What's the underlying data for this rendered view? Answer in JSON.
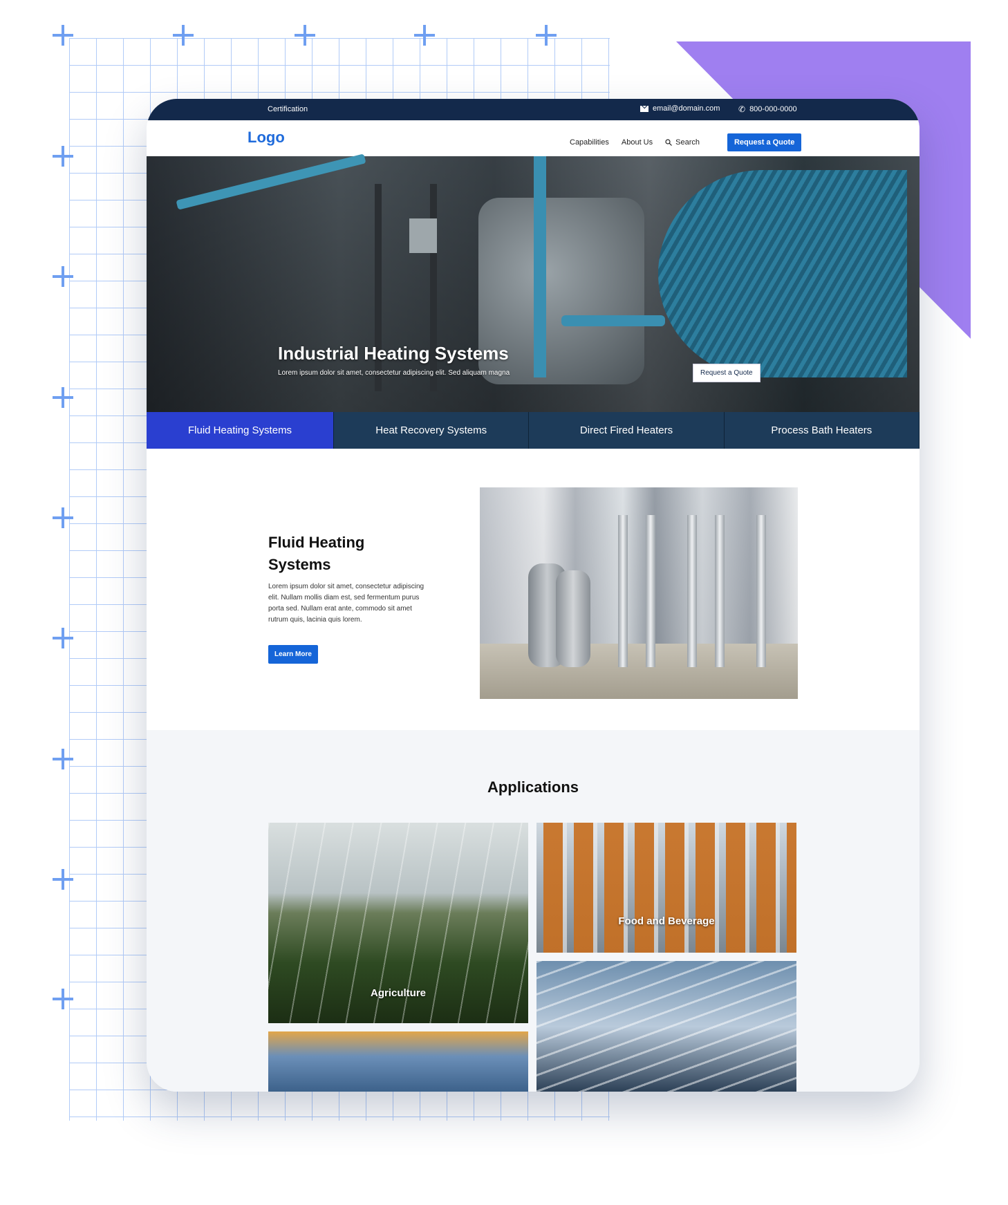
{
  "topbar": {
    "certification": "Certification",
    "email": "email@domain.com",
    "phone": "800-000-0000"
  },
  "header": {
    "logo": "Logo",
    "nav": [
      "Capabilities",
      "About Us"
    ],
    "search": "Search",
    "quote_button": "Request a Quote"
  },
  "hero": {
    "title": "Industrial Heating Systems",
    "subtitle": "Lorem ipsum dolor sit amet, consectetur adipiscing elit. Sed aliquam magna",
    "button": "Request a Quote"
  },
  "tabs": [
    {
      "label": "Fluid Heating Systems",
      "active": true
    },
    {
      "label": "Heat Recovery Systems",
      "active": false
    },
    {
      "label": "Direct Fired Heaters",
      "active": false
    },
    {
      "label": "Process Bath Heaters",
      "active": false
    }
  ],
  "feature": {
    "title": "Fluid Heating Systems",
    "body": "Lorem ipsum dolor sit amet, consectetur adipiscing elit. Nullam mollis diam est, sed fermentum purus porta sed. Nullam erat ante, commodo sit amet rutrum quis, lacinia quis lorem.",
    "button": "Learn More"
  },
  "applications": {
    "title": "Applications",
    "items": [
      {
        "label": "Agriculture"
      },
      {
        "label": "Food and Beverage"
      }
    ]
  },
  "colors": {
    "topbar": "#13294b",
    "accent_blue": "#1565d8",
    "active_tab": "#2a3fd0",
    "tab_bar": "#1d3b59",
    "purple": "#9f7ff0"
  }
}
